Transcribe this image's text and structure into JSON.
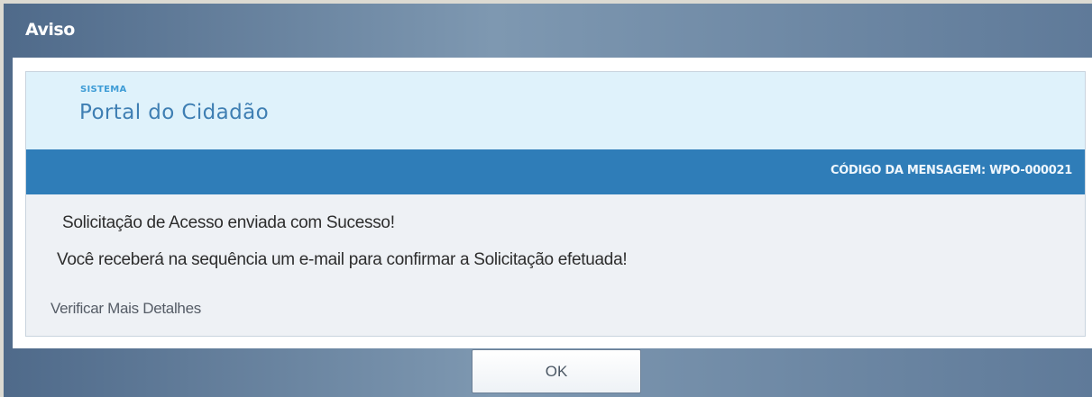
{
  "dialog": {
    "title": "Aviso",
    "system_label": "SISTEMA",
    "system_name": "Portal do Cidadão",
    "message_code": "CÓDIGO DA MENSAGEM: WPO-000021",
    "messages": [
      "Solicitação de Acesso enviada com Sucesso!",
      "Você receberá na sequência um e-mail para confirmar a Solicitação efetuada!"
    ],
    "details_link": "Verificar Mais Detalhes",
    "ok_label": "OK"
  },
  "colors": {
    "header_bg": "#dff2fb",
    "code_bar_bg": "#2f7db8",
    "title_bar_mid": "#7e98b1"
  }
}
